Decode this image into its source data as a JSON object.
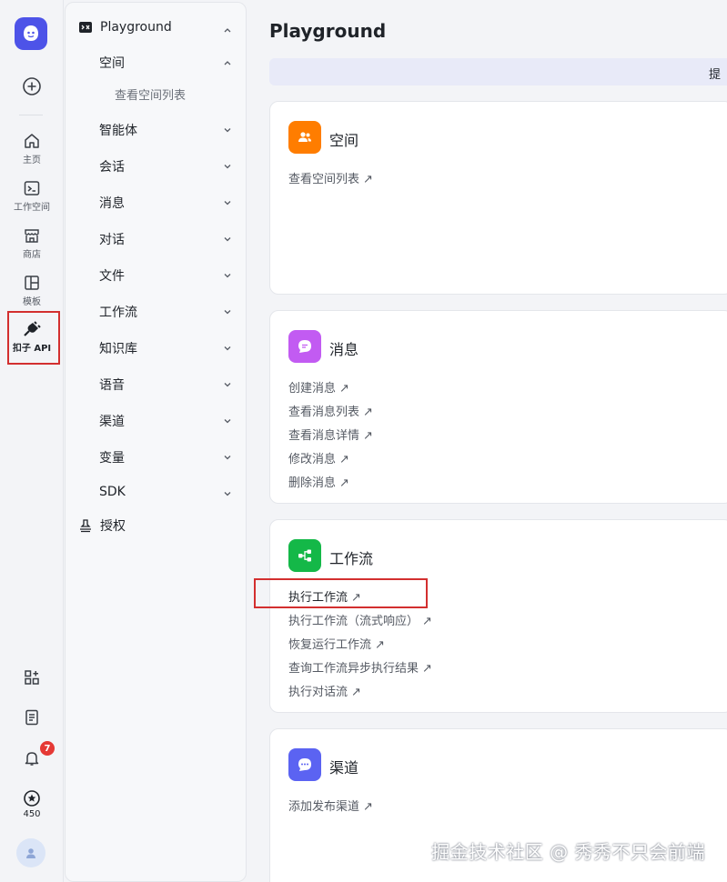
{
  "rail": {
    "items": [
      {
        "label": "主页",
        "icon": "home-icon"
      },
      {
        "label": "工作空间",
        "icon": "terminal-icon"
      },
      {
        "label": "商店",
        "icon": "store-icon"
      },
      {
        "label": "模板",
        "icon": "template-icon"
      },
      {
        "label": "扣子 API",
        "icon": "plug-icon"
      }
    ],
    "notification_count": "7",
    "points": "450"
  },
  "nav": {
    "header": "Playground",
    "space": "空间",
    "space_sub": "查看空间列表",
    "items": [
      "智能体",
      "会话",
      "消息",
      "对话",
      "文件",
      "工作流",
      "知识库",
      "语音",
      "渠道",
      "变量",
      "SDK"
    ],
    "auth": "授权"
  },
  "main": {
    "title": "Playground",
    "tip": "提",
    "cards": [
      {
        "title": "空间",
        "links": [
          "查看空间列表"
        ]
      },
      {
        "title": "消息",
        "links": [
          "创建消息",
          "查看消息列表",
          "查看消息详情",
          "修改消息",
          "删除消息"
        ]
      },
      {
        "title": "工作流",
        "links": [
          "执行工作流",
          "执行工作流（流式响应）",
          "恢复运行工作流",
          "查询工作流异步执行结果",
          "执行对话流"
        ]
      },
      {
        "title": "渠道",
        "links": [
          "添加发布渠道"
        ]
      }
    ],
    "arrow": "↗"
  },
  "watermark": "掘金技术社区 @ 秀秀不只会前端",
  "colors": {
    "accent": "#4d53e8",
    "space_icon": "#ff7d00",
    "message_icon": "#c25bf2",
    "workflow_icon": "#14b848",
    "channel_icon": "#5b63f2",
    "highlight": "#d32f2f"
  }
}
